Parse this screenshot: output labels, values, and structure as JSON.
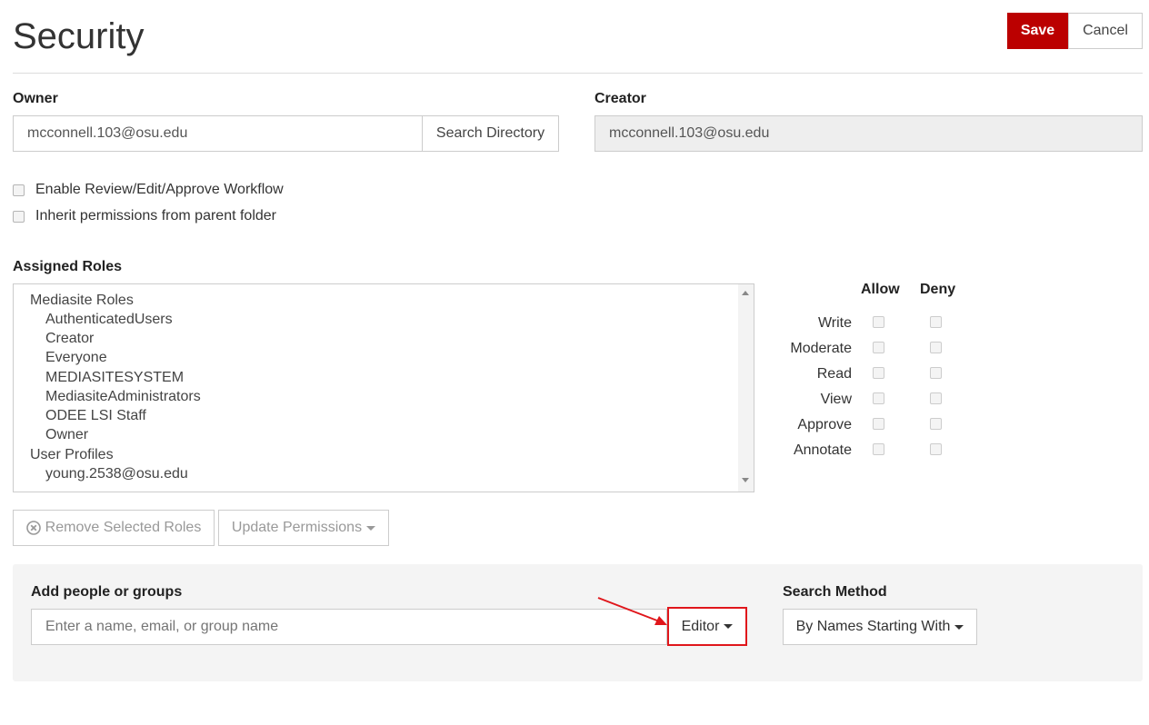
{
  "page": {
    "title": "Security"
  },
  "header": {
    "save_label": "Save",
    "cancel_label": "Cancel"
  },
  "owner": {
    "label": "Owner",
    "value": "mcconnell.103@osu.edu",
    "search_button": "Search Directory"
  },
  "creator": {
    "label": "Creator",
    "value": "mcconnell.103@osu.edu"
  },
  "options": {
    "workflow_label": "Enable Review/Edit/Approve Workflow",
    "inherit_label": "Inherit permissions from parent folder"
  },
  "roles": {
    "label": "Assigned Roles",
    "items": [
      {
        "text": "Mediasite Roles",
        "group": true
      },
      {
        "text": "AuthenticatedUsers",
        "group": false
      },
      {
        "text": "Creator",
        "group": false
      },
      {
        "text": "Everyone",
        "group": false
      },
      {
        "text": "MEDIASITESYSTEM",
        "group": false
      },
      {
        "text": "MediasiteAdministrators",
        "group": false
      },
      {
        "text": "ODEE LSI Staff",
        "group": false
      },
      {
        "text": "Owner",
        "group": false
      },
      {
        "text": "User Profiles",
        "group": true
      },
      {
        "text": "young.2538@osu.edu",
        "group": false
      }
    ]
  },
  "permissions": {
    "allow_header": "Allow",
    "deny_header": "Deny",
    "rows": [
      "Write",
      "Moderate",
      "Read",
      "View",
      "Approve",
      "Annotate"
    ]
  },
  "actions": {
    "remove_label": "Remove Selected Roles",
    "update_label": "Update Permissions"
  },
  "add": {
    "label": "Add people or groups",
    "placeholder": "Enter a name, email, or group name",
    "role_select": "Editor",
    "search_method_label": "Search Method",
    "search_method_value": "By Names Starting With"
  },
  "colors": {
    "accent": "#bb0000",
    "annotation": "#e0161b"
  }
}
